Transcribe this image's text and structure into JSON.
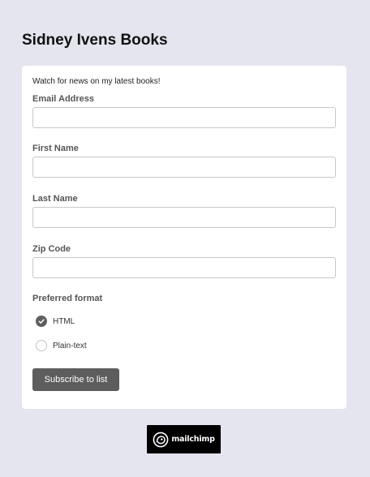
{
  "header": {
    "title": "Sidney Ivens Books"
  },
  "form": {
    "intro": "Watch for news on my latest books!",
    "fields": [
      {
        "label": "Email Address",
        "value": "",
        "placeholder": ""
      },
      {
        "label": "First Name",
        "value": "",
        "placeholder": ""
      },
      {
        "label": "Last Name",
        "value": "",
        "placeholder": ""
      },
      {
        "label": "Zip Code",
        "value": "",
        "placeholder": ""
      }
    ],
    "format": {
      "label": "Preferred format",
      "options": [
        {
          "label": "HTML",
          "selected": true
        },
        {
          "label": "Plain-text",
          "selected": false
        }
      ]
    },
    "submit_label": "Subscribe to list"
  },
  "footer": {
    "badge_text": "mailchimp",
    "badge_icon": "mailchimp-logo-icon"
  },
  "colors": {
    "page_background": "#e5e5ef",
    "card_background": "#ffffff",
    "button_background": "#5d5d5d",
    "badge_background": "#000000"
  }
}
